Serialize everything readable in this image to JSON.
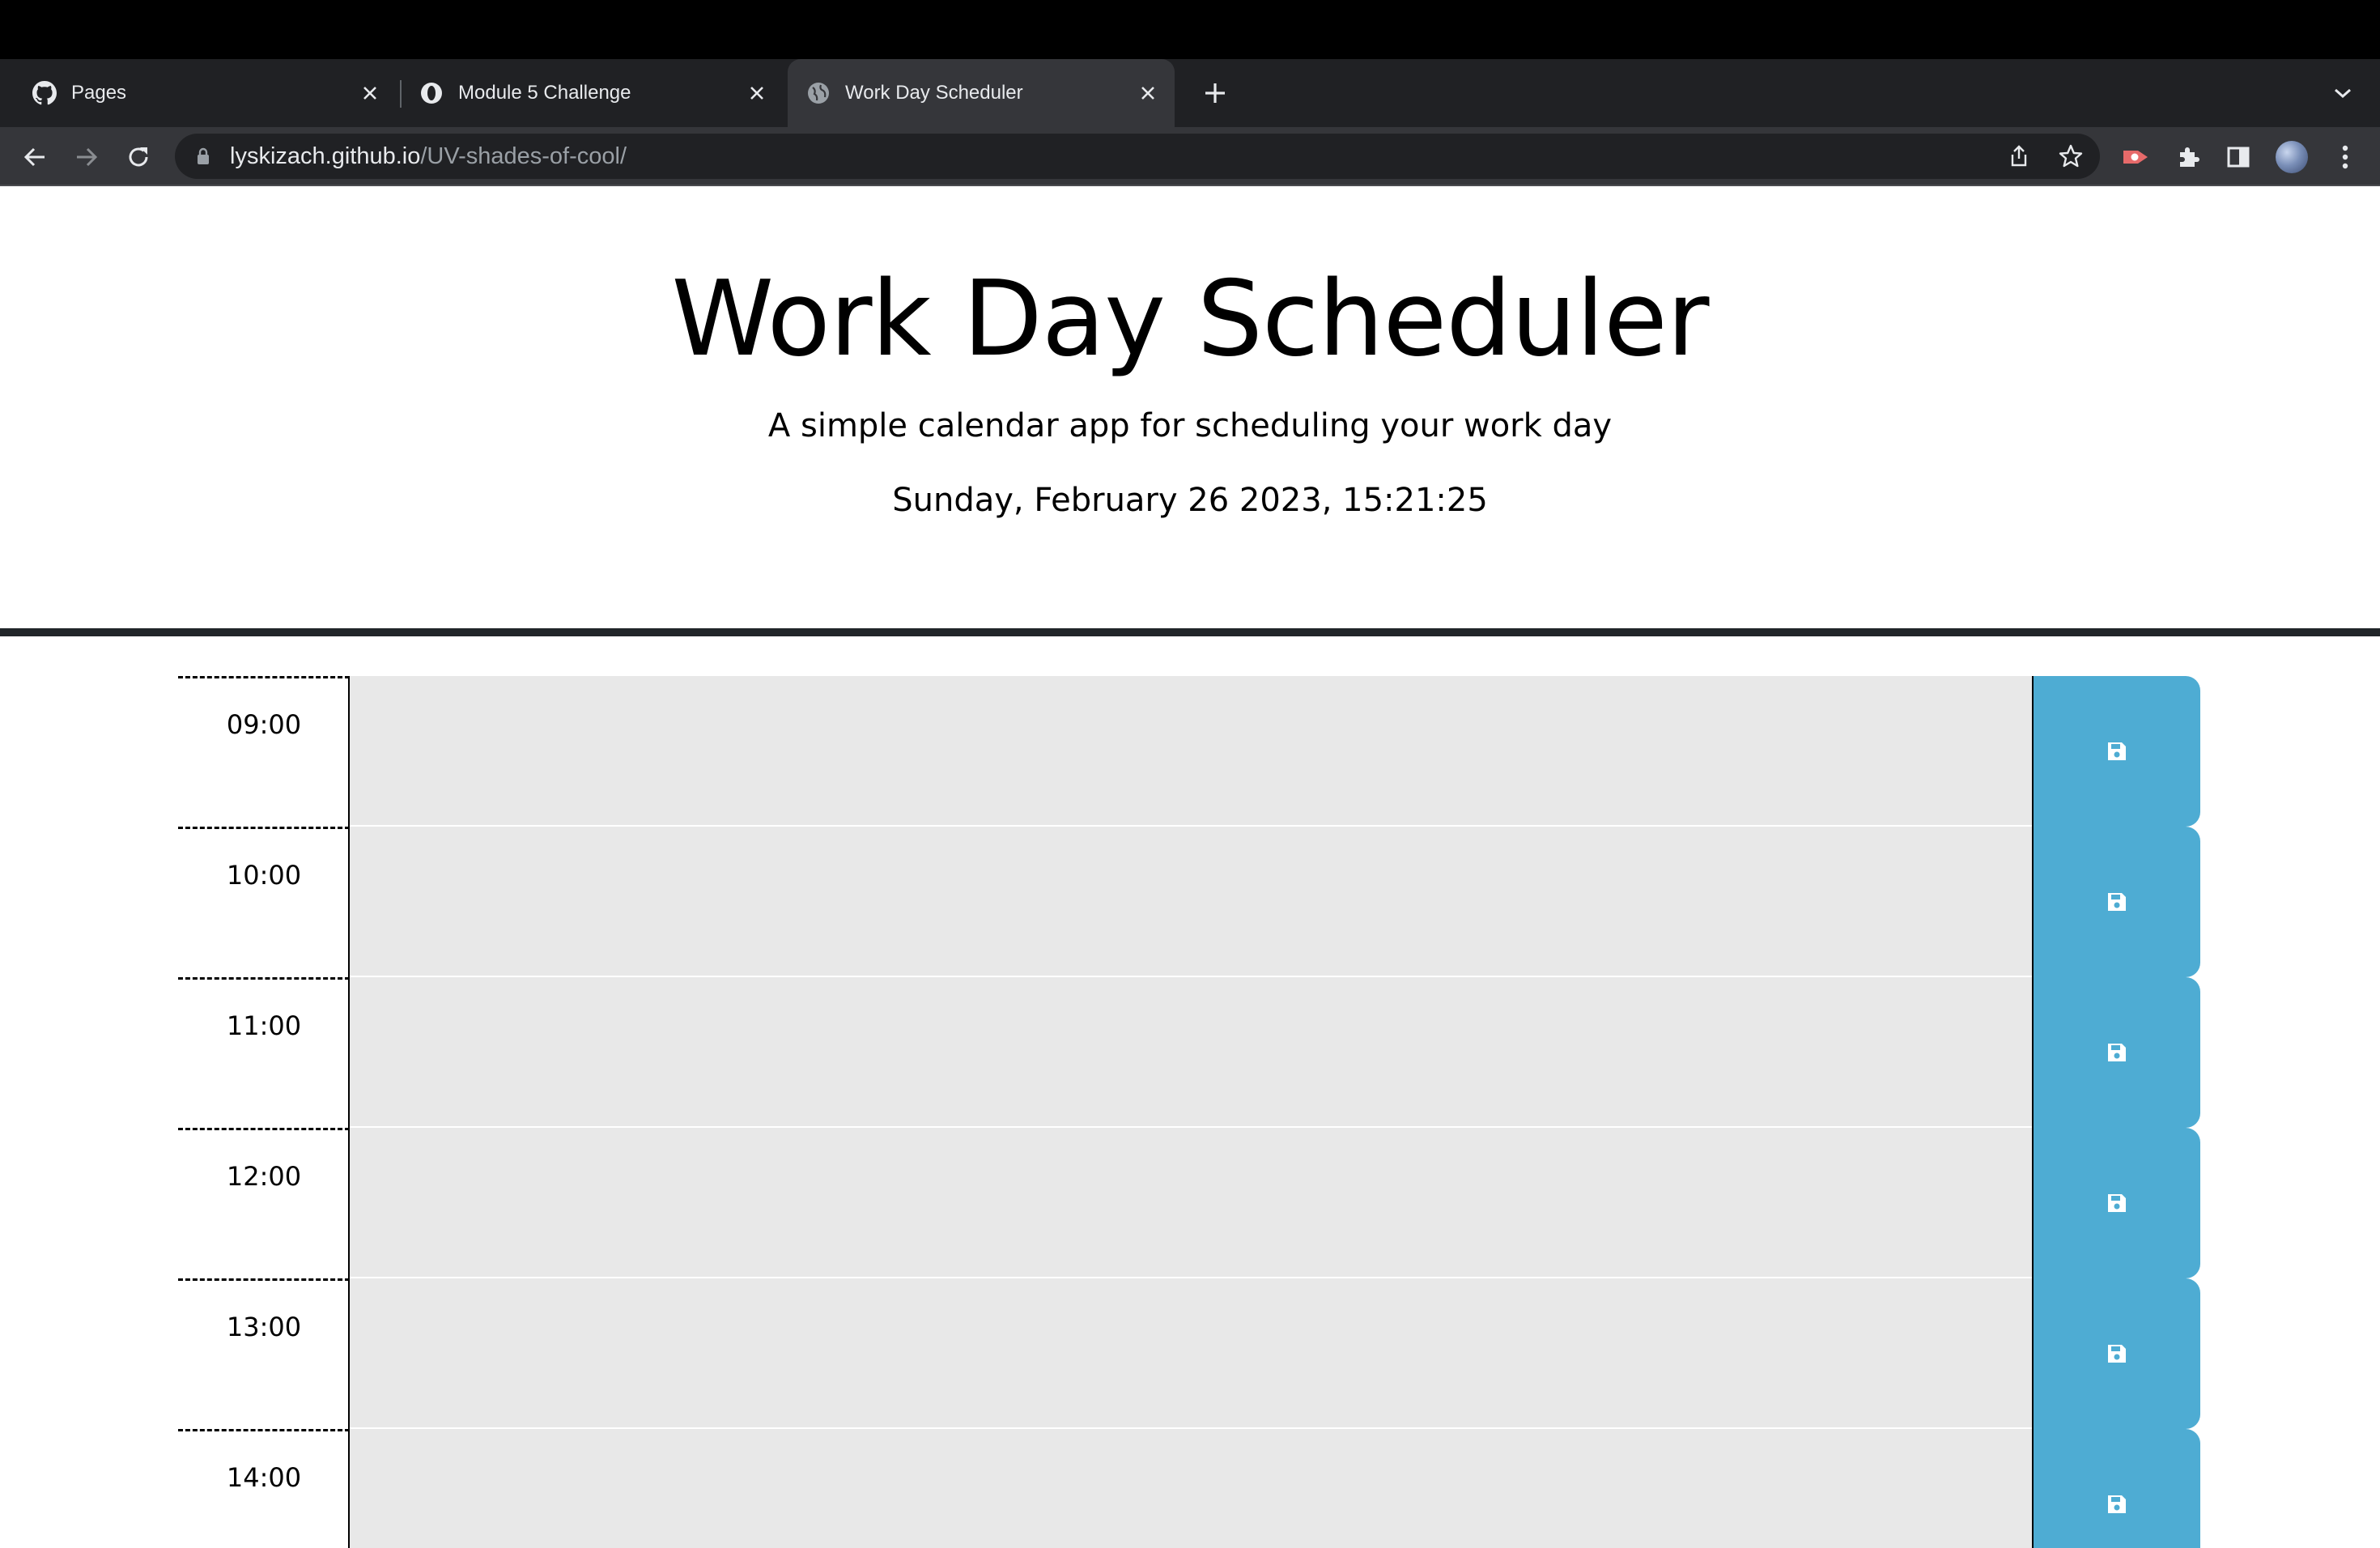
{
  "browser": {
    "tabs": [
      {
        "title": "Pages",
        "icon": "github-icon",
        "active": false
      },
      {
        "title": "Module 5 Challenge",
        "icon": "circle-o-icon",
        "active": false
      },
      {
        "title": "Work Day Scheduler",
        "icon": "globe-icon",
        "active": true
      }
    ],
    "url_host": "lyskizach.github.io",
    "url_path": "/UV-shades-of-cool/"
  },
  "header": {
    "title": "Work Day Scheduler",
    "subtitle": "A simple calendar app for scheduling your work day",
    "current_datetime": "Sunday, February 26 2023, 15:21:25"
  },
  "schedule": {
    "rows": [
      {
        "hour": "09:00",
        "text": ""
      },
      {
        "hour": "10:00",
        "text": ""
      },
      {
        "hour": "11:00",
        "text": ""
      },
      {
        "hour": "12:00",
        "text": ""
      },
      {
        "hour": "13:00",
        "text": ""
      },
      {
        "hour": "14:00",
        "text": ""
      }
    ],
    "save_icon": "save-icon"
  },
  "colors": {
    "save_button": "#4eacd3",
    "textarea_bg": "#e8e8e8",
    "divider": "#212529"
  }
}
